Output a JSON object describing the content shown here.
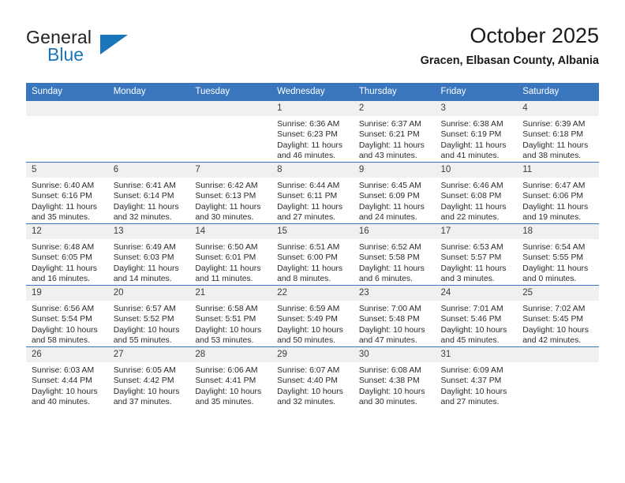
{
  "brand": {
    "word1": "General",
    "word2": "Blue",
    "logo_icon": "blue-triangle-icon",
    "accent_color": "#1b75bb"
  },
  "header": {
    "title": "October 2025",
    "subtitle": "Gracen, Elbasan County, Albania"
  },
  "theme": {
    "header_bar_color": "#3a76bd",
    "daynum_band_color": "#f0f0f0",
    "text_color": "#2b2b2b"
  },
  "weekdays": [
    "Sunday",
    "Monday",
    "Tuesday",
    "Wednesday",
    "Thursday",
    "Friday",
    "Saturday"
  ],
  "labels": {
    "sunrise": "Sunrise:",
    "sunset": "Sunset:",
    "daylight": "Daylight:"
  },
  "weeks": [
    [
      {
        "day": "",
        "empty": true
      },
      {
        "day": "",
        "empty": true
      },
      {
        "day": "",
        "empty": true
      },
      {
        "day": "1",
        "sunrise": "Sunrise: 6:36 AM",
        "sunset": "Sunset: 6:23 PM",
        "daylight1": "Daylight: 11 hours",
        "daylight2": "and 46 minutes."
      },
      {
        "day": "2",
        "sunrise": "Sunrise: 6:37 AM",
        "sunset": "Sunset: 6:21 PM",
        "daylight1": "Daylight: 11 hours",
        "daylight2": "and 43 minutes."
      },
      {
        "day": "3",
        "sunrise": "Sunrise: 6:38 AM",
        "sunset": "Sunset: 6:19 PM",
        "daylight1": "Daylight: 11 hours",
        "daylight2": "and 41 minutes."
      },
      {
        "day": "4",
        "sunrise": "Sunrise: 6:39 AM",
        "sunset": "Sunset: 6:18 PM",
        "daylight1": "Daylight: 11 hours",
        "daylight2": "and 38 minutes."
      }
    ],
    [
      {
        "day": "5",
        "sunrise": "Sunrise: 6:40 AM",
        "sunset": "Sunset: 6:16 PM",
        "daylight1": "Daylight: 11 hours",
        "daylight2": "and 35 minutes."
      },
      {
        "day": "6",
        "sunrise": "Sunrise: 6:41 AM",
        "sunset": "Sunset: 6:14 PM",
        "daylight1": "Daylight: 11 hours",
        "daylight2": "and 32 minutes."
      },
      {
        "day": "7",
        "sunrise": "Sunrise: 6:42 AM",
        "sunset": "Sunset: 6:13 PM",
        "daylight1": "Daylight: 11 hours",
        "daylight2": "and 30 minutes."
      },
      {
        "day": "8",
        "sunrise": "Sunrise: 6:44 AM",
        "sunset": "Sunset: 6:11 PM",
        "daylight1": "Daylight: 11 hours",
        "daylight2": "and 27 minutes."
      },
      {
        "day": "9",
        "sunrise": "Sunrise: 6:45 AM",
        "sunset": "Sunset: 6:09 PM",
        "daylight1": "Daylight: 11 hours",
        "daylight2": "and 24 minutes."
      },
      {
        "day": "10",
        "sunrise": "Sunrise: 6:46 AM",
        "sunset": "Sunset: 6:08 PM",
        "daylight1": "Daylight: 11 hours",
        "daylight2": "and 22 minutes."
      },
      {
        "day": "11",
        "sunrise": "Sunrise: 6:47 AM",
        "sunset": "Sunset: 6:06 PM",
        "daylight1": "Daylight: 11 hours",
        "daylight2": "and 19 minutes."
      }
    ],
    [
      {
        "day": "12",
        "sunrise": "Sunrise: 6:48 AM",
        "sunset": "Sunset: 6:05 PM",
        "daylight1": "Daylight: 11 hours",
        "daylight2": "and 16 minutes."
      },
      {
        "day": "13",
        "sunrise": "Sunrise: 6:49 AM",
        "sunset": "Sunset: 6:03 PM",
        "daylight1": "Daylight: 11 hours",
        "daylight2": "and 14 minutes."
      },
      {
        "day": "14",
        "sunrise": "Sunrise: 6:50 AM",
        "sunset": "Sunset: 6:01 PM",
        "daylight1": "Daylight: 11 hours",
        "daylight2": "and 11 minutes."
      },
      {
        "day": "15",
        "sunrise": "Sunrise: 6:51 AM",
        "sunset": "Sunset: 6:00 PM",
        "daylight1": "Daylight: 11 hours",
        "daylight2": "and 8 minutes."
      },
      {
        "day": "16",
        "sunrise": "Sunrise: 6:52 AM",
        "sunset": "Sunset: 5:58 PM",
        "daylight1": "Daylight: 11 hours",
        "daylight2": "and 6 minutes."
      },
      {
        "day": "17",
        "sunrise": "Sunrise: 6:53 AM",
        "sunset": "Sunset: 5:57 PM",
        "daylight1": "Daylight: 11 hours",
        "daylight2": "and 3 minutes."
      },
      {
        "day": "18",
        "sunrise": "Sunrise: 6:54 AM",
        "sunset": "Sunset: 5:55 PM",
        "daylight1": "Daylight: 11 hours",
        "daylight2": "and 0 minutes."
      }
    ],
    [
      {
        "day": "19",
        "sunrise": "Sunrise: 6:56 AM",
        "sunset": "Sunset: 5:54 PM",
        "daylight1": "Daylight: 10 hours",
        "daylight2": "and 58 minutes."
      },
      {
        "day": "20",
        "sunrise": "Sunrise: 6:57 AM",
        "sunset": "Sunset: 5:52 PM",
        "daylight1": "Daylight: 10 hours",
        "daylight2": "and 55 minutes."
      },
      {
        "day": "21",
        "sunrise": "Sunrise: 6:58 AM",
        "sunset": "Sunset: 5:51 PM",
        "daylight1": "Daylight: 10 hours",
        "daylight2": "and 53 minutes."
      },
      {
        "day": "22",
        "sunrise": "Sunrise: 6:59 AM",
        "sunset": "Sunset: 5:49 PM",
        "daylight1": "Daylight: 10 hours",
        "daylight2": "and 50 minutes."
      },
      {
        "day": "23",
        "sunrise": "Sunrise: 7:00 AM",
        "sunset": "Sunset: 5:48 PM",
        "daylight1": "Daylight: 10 hours",
        "daylight2": "and 47 minutes."
      },
      {
        "day": "24",
        "sunrise": "Sunrise: 7:01 AM",
        "sunset": "Sunset: 5:46 PM",
        "daylight1": "Daylight: 10 hours",
        "daylight2": "and 45 minutes."
      },
      {
        "day": "25",
        "sunrise": "Sunrise: 7:02 AM",
        "sunset": "Sunset: 5:45 PM",
        "daylight1": "Daylight: 10 hours",
        "daylight2": "and 42 minutes."
      }
    ],
    [
      {
        "day": "26",
        "sunrise": "Sunrise: 6:03 AM",
        "sunset": "Sunset: 4:44 PM",
        "daylight1": "Daylight: 10 hours",
        "daylight2": "and 40 minutes."
      },
      {
        "day": "27",
        "sunrise": "Sunrise: 6:05 AM",
        "sunset": "Sunset: 4:42 PM",
        "daylight1": "Daylight: 10 hours",
        "daylight2": "and 37 minutes."
      },
      {
        "day": "28",
        "sunrise": "Sunrise: 6:06 AM",
        "sunset": "Sunset: 4:41 PM",
        "daylight1": "Daylight: 10 hours",
        "daylight2": "and 35 minutes."
      },
      {
        "day": "29",
        "sunrise": "Sunrise: 6:07 AM",
        "sunset": "Sunset: 4:40 PM",
        "daylight1": "Daylight: 10 hours",
        "daylight2": "and 32 minutes."
      },
      {
        "day": "30",
        "sunrise": "Sunrise: 6:08 AM",
        "sunset": "Sunset: 4:38 PM",
        "daylight1": "Daylight: 10 hours",
        "daylight2": "and 30 minutes."
      },
      {
        "day": "31",
        "sunrise": "Sunrise: 6:09 AM",
        "sunset": "Sunset: 4:37 PM",
        "daylight1": "Daylight: 10 hours",
        "daylight2": "and 27 minutes."
      },
      {
        "day": "",
        "empty": true
      }
    ]
  ]
}
